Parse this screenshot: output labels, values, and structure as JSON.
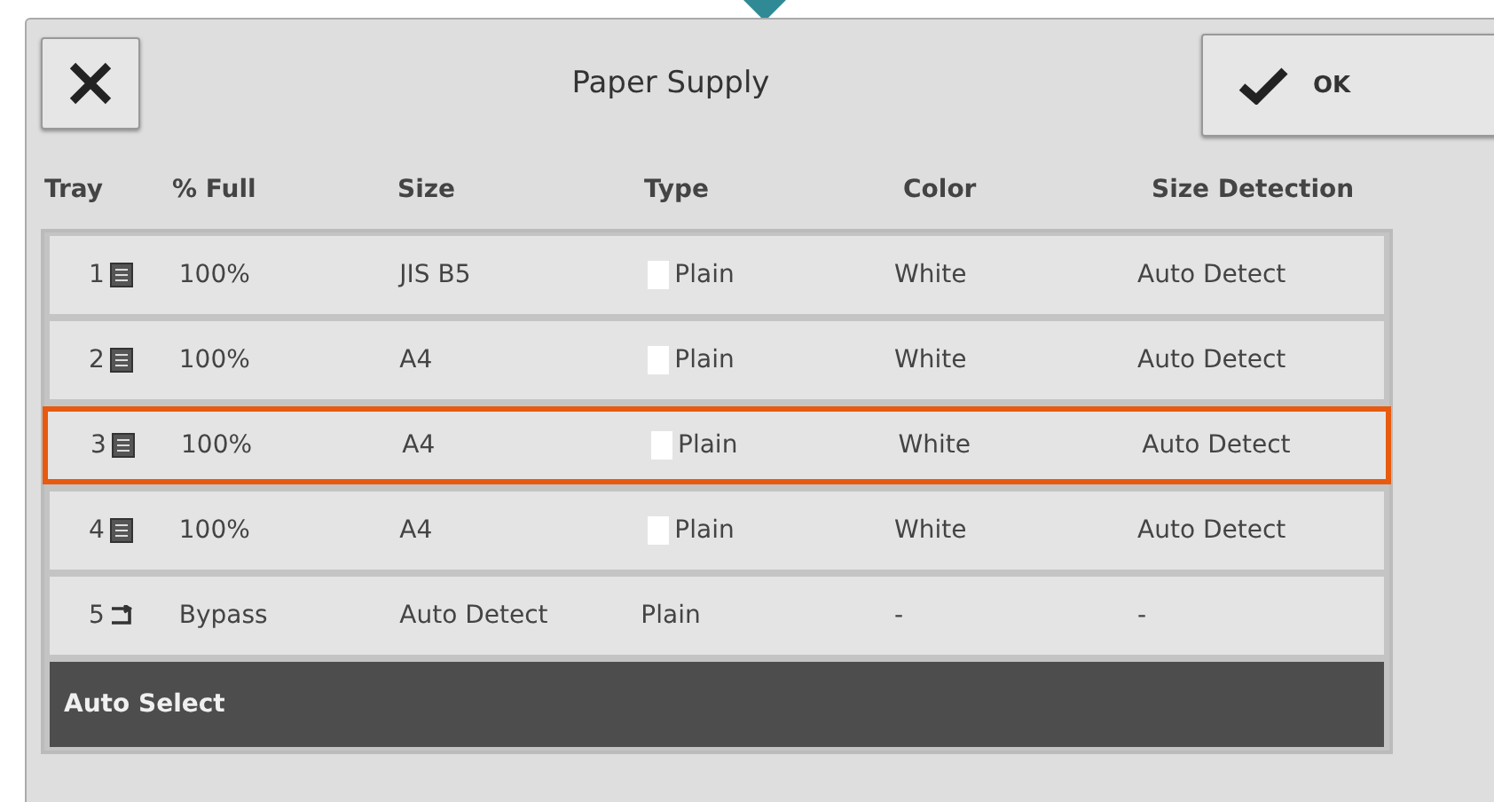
{
  "title": "Paper Supply",
  "ok_button": {
    "label": "OK"
  },
  "columns": [
    "Tray",
    "% Full",
    "Size",
    "Type",
    "Color",
    "Size Detection"
  ],
  "rows": [
    {
      "tray": "1",
      "kind": "tray",
      "full": "100%",
      "size": "JIS B5",
      "swatch": true,
      "type": "Plain",
      "paper_color": "White",
      "detection": "Auto Detect",
      "highlighted": false
    },
    {
      "tray": "2",
      "kind": "tray",
      "full": "100%",
      "size": "A4",
      "swatch": true,
      "type": "Plain",
      "paper_color": "White",
      "detection": "Auto Detect",
      "highlighted": false
    },
    {
      "tray": "3",
      "kind": "tray",
      "full": "100%",
      "size": "A4",
      "swatch": true,
      "type": "Plain",
      "paper_color": "White",
      "detection": "Auto Detect",
      "highlighted": true
    },
    {
      "tray": "4",
      "kind": "tray",
      "full": "100%",
      "size": "A4",
      "swatch": true,
      "type": "Plain",
      "paper_color": "White",
      "detection": "Auto Detect",
      "highlighted": false
    },
    {
      "tray": "5",
      "kind": "bypass",
      "full": "Bypass",
      "size": "Auto Detect",
      "swatch": false,
      "type": "Plain",
      "paper_color": "-",
      "detection": "-",
      "highlighted": false
    }
  ],
  "auto_select": {
    "label": "Auto Select",
    "selected": true
  }
}
